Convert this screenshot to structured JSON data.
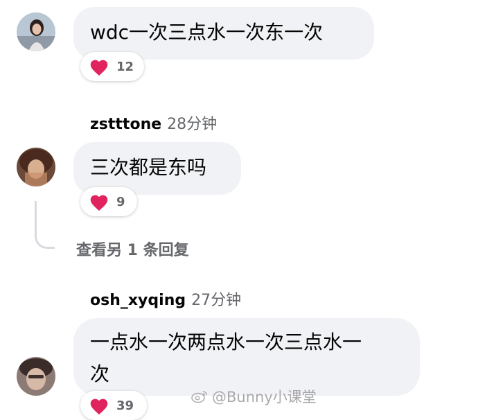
{
  "comments": [
    {
      "text": "wdc一次三点水一次东一次",
      "reaction_count": "12"
    },
    {
      "username": "zstttone",
      "time": "28分钟",
      "text": "三次都是东吗",
      "reaction_count": "9",
      "view_more": "查看另 1 条回复"
    },
    {
      "username": "osh_xyqing",
      "time": "27分钟",
      "text_line1": "一点水一次两点水一次三点水一",
      "text_line2": "次",
      "reaction_count": "39"
    }
  ],
  "icons": {
    "reaction": "red-heart-icon",
    "watermark": "weibo-icon"
  },
  "colors": {
    "bubble": "#f0f2f5",
    "secondary_text": "#65676b",
    "heart": "#e0245e"
  },
  "watermark": {
    "text": "@Bunny小课堂"
  }
}
